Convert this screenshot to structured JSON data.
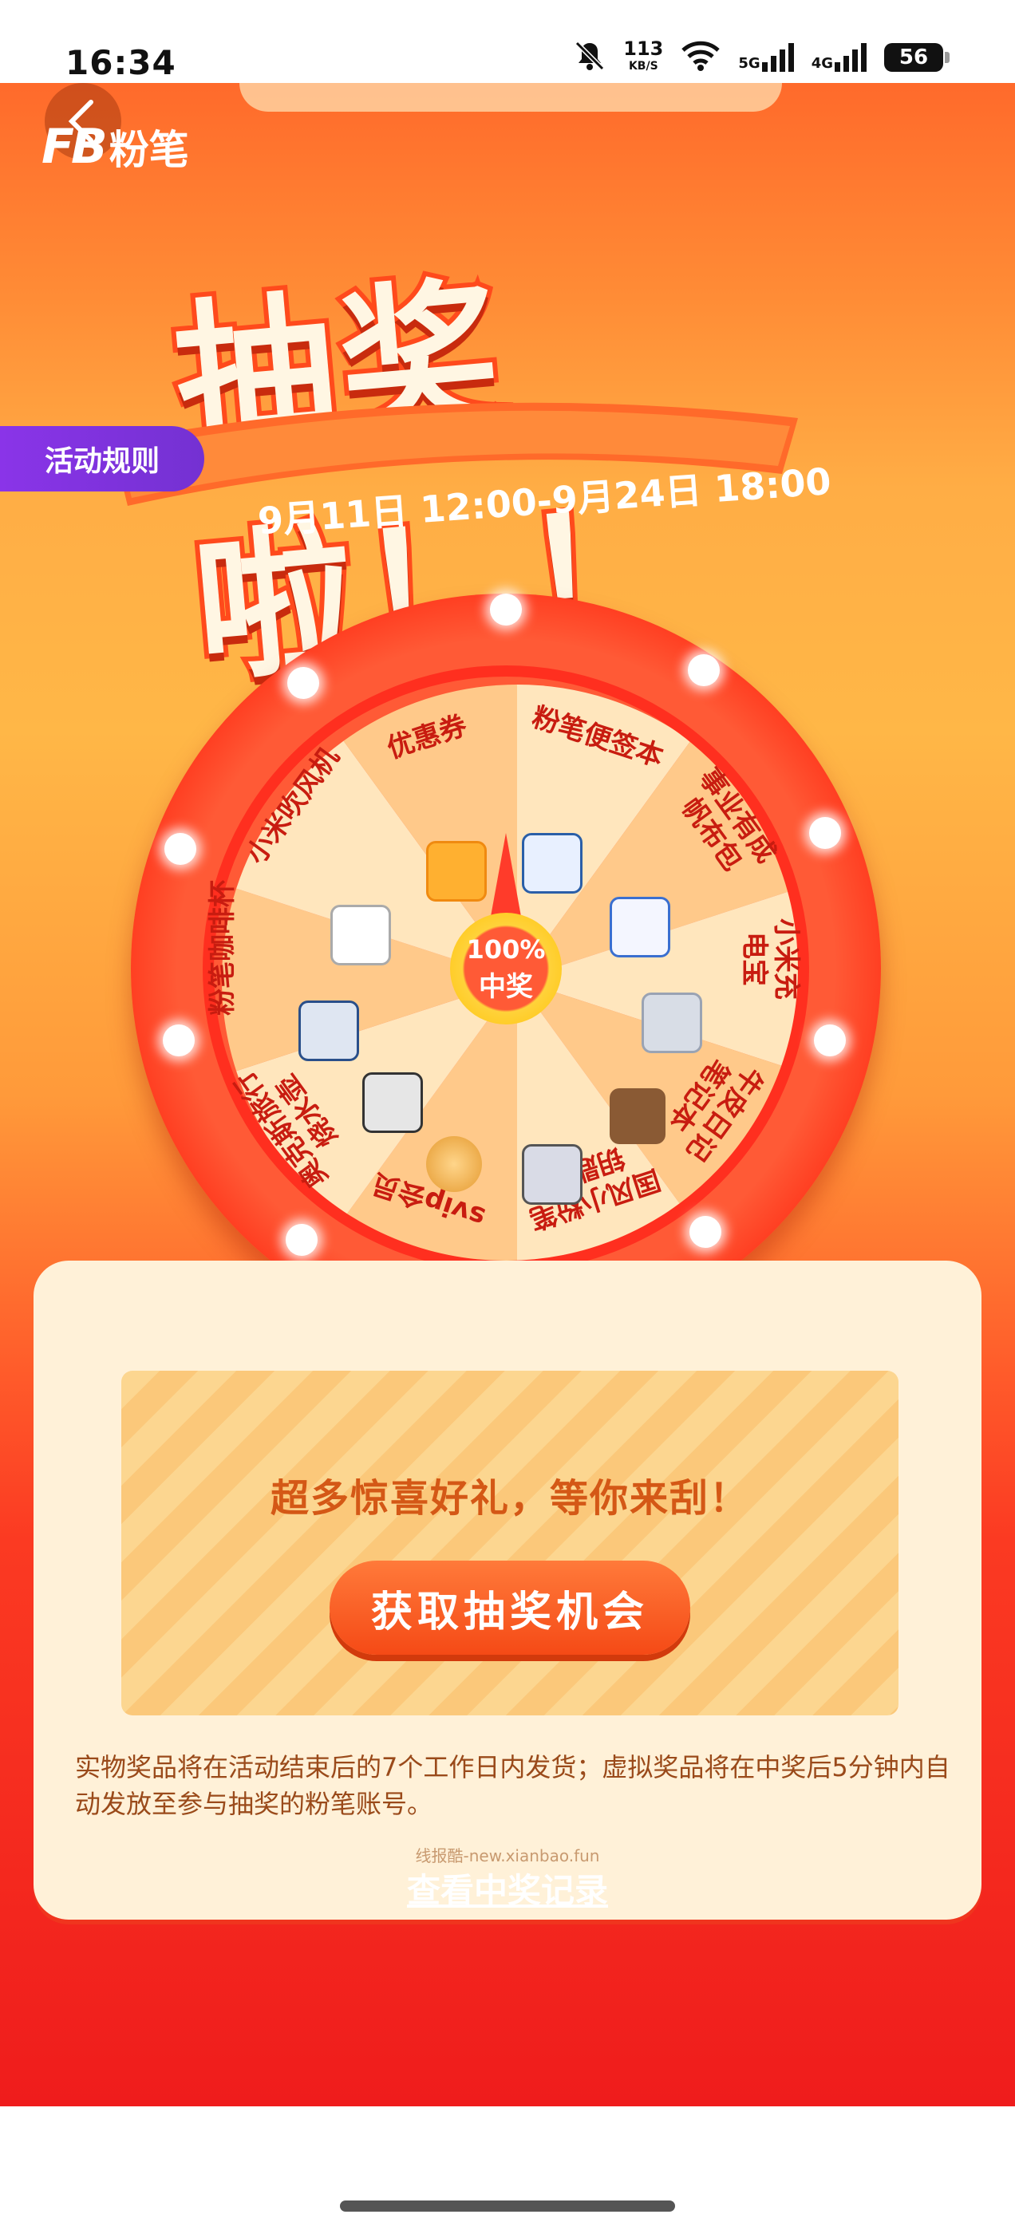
{
  "status_bar": {
    "time": "16:34",
    "speed_value": "113",
    "speed_unit": "KB/S",
    "net1": "5G",
    "net2": "4G",
    "battery": "56"
  },
  "header": {
    "logo_mark": "FB",
    "logo_text": "粉笔"
  },
  "banner": {
    "title": "抽奖啦！！",
    "date_range": "9月11日 12:00-9月24日 18:00",
    "rules_button": "活动规则"
  },
  "wheel": {
    "center_percent": "100%",
    "center_label": "中奖",
    "prizes": [
      "粉笔便签本",
      "事业有成\n帆布包",
      "小米充\n电宝",
      "牛皮日记\n笔记本",
      "国风小粉笔\n钥匙扣",
      "svip会员",
      "奥克斯旅行\n烧水壶",
      "粉笔咖啡杯",
      "小米吹风机",
      "优惠券"
    ]
  },
  "card": {
    "slogan": "超多惊喜好礼，等你来刮！",
    "action_button": "获取抽奖机会",
    "note": "实物奖品将在活动结束后的7个工作日内发货；虚拟奖品将在中奖后5分钟内自动发放至参与抽奖的粉笔账号。",
    "watermark": "线报酷-new.xianbao.fun",
    "record_link": "查看中奖记录"
  },
  "colors": {
    "accent": "#ff5a2a",
    "rules_purple": "#7a33dd",
    "card_bg": "#fff1d8"
  }
}
